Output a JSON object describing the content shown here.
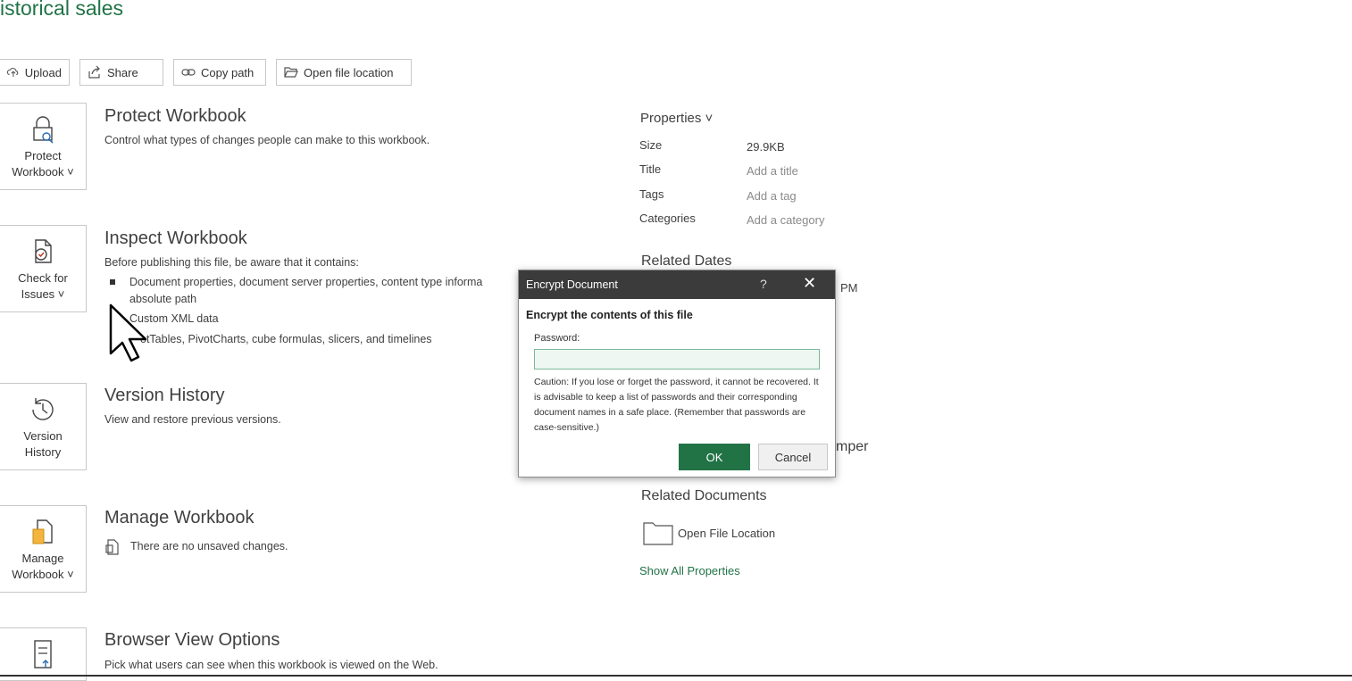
{
  "title": "istorical sales",
  "toolbar": {
    "upload": "Upload",
    "share": "Share",
    "copy_path": "Copy path",
    "open_file_location": "Open file location"
  },
  "sections": {
    "protect": {
      "tile_line1": "Protect",
      "tile_line2": "Workbook ˅",
      "heading": "Protect Workbook",
      "desc": "Control what types of changes people can make to this workbook."
    },
    "inspect": {
      "tile_line1": "Check for",
      "tile_line2": "Issues ˅",
      "heading": "Inspect Workbook",
      "desc": "Before publishing this file, be aware that it contains:",
      "items": [
        "Document properties, document server properties, content type informa",
        "absolute path",
        "Custom XML data",
        "otTables, PivotCharts, cube formulas, slicers, and timelines"
      ]
    },
    "version": {
      "tile_line1": "Version",
      "tile_line2": "History",
      "heading": "Version History",
      "desc": "View and restore previous versions."
    },
    "manage": {
      "tile_line1": "Manage",
      "tile_line2": "Workbook ˅",
      "heading": "Manage Workbook",
      "desc": "There are no unsaved changes."
    },
    "browser": {
      "heading": "Browser View Options",
      "desc": "Pick what users can see when this workbook is viewed on the Web."
    }
  },
  "properties": {
    "heading": "Properties ˅",
    "rows": [
      {
        "key": "Size",
        "value": "29.9KB"
      },
      {
        "key": "Title",
        "value": "Add a title"
      },
      {
        "key": "Tags",
        "value": "Add a tag"
      },
      {
        "key": "Categories",
        "value": "Add a category"
      }
    ],
    "related_dates": "Related Dates",
    "partial_time": "PM",
    "partial_mper": "mper",
    "related_documents": "Related Documents",
    "open_file_location": "Open File Location",
    "show_all": "Show All Properties"
  },
  "dialog": {
    "title": "Encrypt Document",
    "help": "?",
    "close": "✕",
    "heading": "Encrypt the contents of this file",
    "password_label": "Password:",
    "password_value": "",
    "caution": "Caution: If you lose or forget the password, it cannot be recovered. It is advisable to keep a list of passwords and their corresponding document names in a safe place. (Remember that passwords are case-sensitive.)",
    "ok": "OK",
    "cancel": "Cancel"
  },
  "colors": {
    "accent": "#217346",
    "dialog_bar": "#3b3b3b"
  }
}
